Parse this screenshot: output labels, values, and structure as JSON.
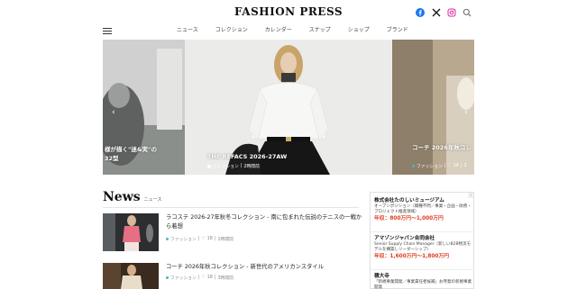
{
  "site": {
    "logo": "FASHION PRESS"
  },
  "header": {
    "icons": [
      "facebook-icon",
      "x-icon",
      "instagram-icon",
      "search-icon"
    ]
  },
  "nav": {
    "items": [
      {
        "label": "ニュース"
      },
      {
        "label": "コレクション"
      },
      {
        "label": "カレンダー"
      },
      {
        "label": "スナップ"
      },
      {
        "label": "ショップ"
      },
      {
        "label": "ブランド"
      }
    ]
  },
  "carousel": {
    "left": {
      "caption_line1": "様が描く\"迷&実\"の",
      "caption_line2": "32型"
    },
    "center": {
      "title": "THE REFACS 2026-27AW",
      "category": "コレクション",
      "time": "2時間前"
    },
    "right": {
      "title": "コーチ 2026年秋コレ",
      "category": "ファッション",
      "likes": "14",
      "time": "3"
    }
  },
  "news": {
    "title": "News",
    "subtitle": "ニュース",
    "articles": [
      {
        "title": "ラコステ 2026-27年秋冬コレクション - 南に包まれた伝説のテニスの一戦から着想",
        "category": "ファッション",
        "likes": "18",
        "time": "1時間前"
      },
      {
        "title": "コーチ 2026年秋コレクション - 新世代のアメリカンスタイル",
        "category": "ファッション",
        "likes": "18",
        "time": "3時間前"
      }
    ]
  },
  "ad": {
    "badge": "i",
    "jobs": [
      {
        "company": "株式会社たのしいミュージアム",
        "desc": "オープンポジション（職種不問／事業・企画・財務・プロジェクト推進領域）",
        "salary": "年収：800万円〜1,000万円"
      },
      {
        "company": "アマゾンジャパン合同会社",
        "desc": "Senior Supply Chain Manager（新しいB2B物流モデルを構築しリーダーシップ）",
        "salary": "年収：1,600万円〜1,800万円"
      },
      {
        "company": "積大寺",
        "desc": "「新規事業開発／事業責任者候補」お寺発の新規事業開発",
        "salary": ""
      }
    ]
  },
  "colors": {
    "accent_teal": "#4cb5c2",
    "salary_red": "#e03c1f",
    "facebook_blue": "#1877f2",
    "instagram_pink": "#d6249f"
  }
}
